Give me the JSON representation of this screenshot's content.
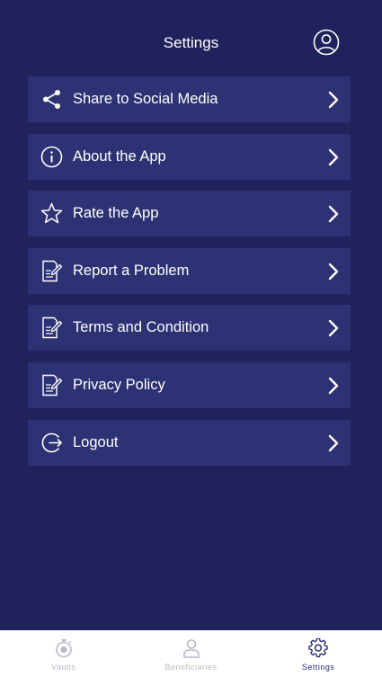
{
  "header": {
    "title": "Settings",
    "profile_icon": "user-circle-icon"
  },
  "menu": {
    "items": [
      {
        "label": "Share to Social Media",
        "icon": "share-icon"
      },
      {
        "label": "About the App",
        "icon": "info-icon"
      },
      {
        "label": "Rate the App",
        "icon": "star-icon"
      },
      {
        "label": "Report a Problem",
        "icon": "document-edit-icon"
      },
      {
        "label": "Terms and Condition",
        "icon": "document-edit-icon"
      },
      {
        "label": "Privacy Policy",
        "icon": "document-edit-icon"
      },
      {
        "label": "Logout",
        "icon": "logout-icon"
      }
    ]
  },
  "tabbar": {
    "tabs": [
      {
        "label": "Vaults",
        "icon": "stopwatch-icon",
        "active": false
      },
      {
        "label": "Beneficiaries",
        "icon": "person-icon",
        "active": false
      },
      {
        "label": "Settings",
        "icon": "gear-icon",
        "active": true
      }
    ]
  },
  "colors": {
    "background": "#20225b",
    "menu_item": "#2c3273",
    "tab_active": "#2a2e73",
    "tab_inactive": "#b9b9c6"
  }
}
